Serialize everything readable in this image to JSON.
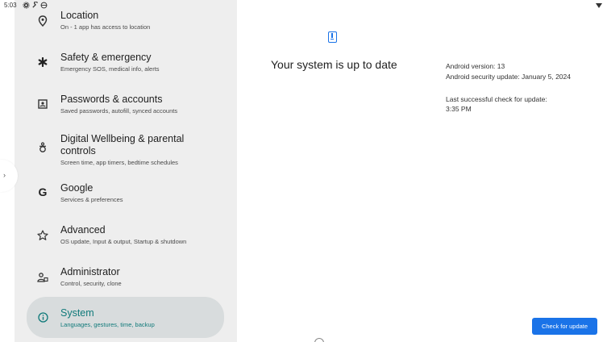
{
  "status_bar": {
    "time": "5:03"
  },
  "sidebar": {
    "items": [
      {
        "title": "Location",
        "subtitle": "On - 1 app has access to location",
        "icon": "location-pin-icon"
      },
      {
        "title": "Safety & emergency",
        "subtitle": "Emergency SOS, medical info, alerts",
        "icon": "asterisk-icon"
      },
      {
        "title": "Passwords & accounts",
        "subtitle": "Saved passwords, autofill, synced accounts",
        "icon": "account-box-icon"
      },
      {
        "title": "Digital Wellbeing & parental controls",
        "subtitle": "Screen time, app timers, bedtime schedules",
        "icon": "wellbeing-icon"
      },
      {
        "title": "Google",
        "subtitle": "Services & preferences",
        "icon": "google-icon"
      },
      {
        "title": "Advanced",
        "subtitle": "OS update, Input & output, Startup & shutdown",
        "icon": "star-outline-icon"
      },
      {
        "title": "Administrator",
        "subtitle": "Control, security, clone",
        "icon": "admin-icon"
      },
      {
        "title": "System",
        "subtitle": "Languages, gestures, time, backup",
        "icon": "info-icon",
        "selected": true
      }
    ]
  },
  "main": {
    "title": "Your system is up to date",
    "android_version": "Android version: 13",
    "security_update": "Android security update: January 5, 2024",
    "last_check_label": "Last successful check for update:",
    "last_check_time": "3:35 PM",
    "check_button": "Check for update"
  },
  "colors": {
    "accent": "#1a73e8",
    "selected_text": "#107a7a",
    "sidebar_bg": "#eeeeee"
  }
}
